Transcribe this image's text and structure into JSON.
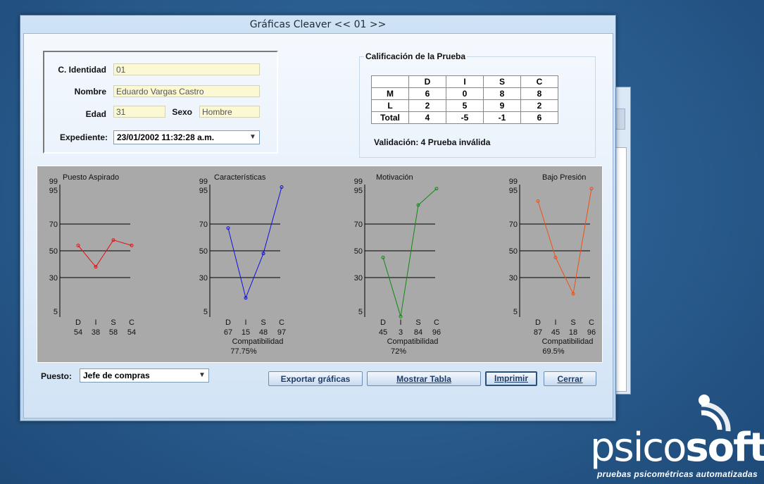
{
  "window": {
    "title": "Gráficas Cleaver << 01 >>"
  },
  "identity": {
    "ci_label": "C. Identidad",
    "ci_value": "01",
    "name_label": "Nombre",
    "name_value": "Eduardo Vargas Castro",
    "age_label": "Edad",
    "age_value": "31",
    "sex_label": "Sexo",
    "sex_value": "Hombre",
    "record_label": "Expediente:",
    "record_value": "23/01/2002 11:32:28 a.m."
  },
  "score": {
    "title": "Calificación de la Prueba",
    "columns": [
      "D",
      "I",
      "S",
      "C"
    ],
    "rows": [
      {
        "label": "M",
        "values": [
          "6",
          "0",
          "8",
          "8"
        ]
      },
      {
        "label": "L",
        "values": [
          "2",
          "5",
          "9",
          "2"
        ]
      },
      {
        "label": "Total",
        "values": [
          "4",
          "-5",
          "-1",
          "6"
        ]
      }
    ],
    "validation": "Validación: 4 Prueba inválida"
  },
  "chart_data": [
    {
      "type": "line",
      "title": "Puesto Aspirado",
      "categories": [
        "D",
        "I",
        "S",
        "C"
      ],
      "values": [
        54,
        38,
        58,
        54
      ],
      "color": "#e01010",
      "compat_label": "",
      "compat_value": ""
    },
    {
      "type": "line",
      "title": "Características",
      "categories": [
        "D",
        "I",
        "S",
        "C"
      ],
      "values": [
        67,
        15,
        48,
        97
      ],
      "color": "#1010e0",
      "compat_label": "Compatibilidad",
      "compat_value": "77.75%"
    },
    {
      "type": "line",
      "title": "Motivación",
      "categories": [
        "D",
        "I",
        "S",
        "C"
      ],
      "values": [
        45,
        3,
        84,
        96
      ],
      "color": "#0f8a0f",
      "compat_label": "Compatibilidad",
      "compat_value": "72%"
    },
    {
      "type": "line",
      "title": "Bajo Presión",
      "categories": [
        "D",
        "I",
        "S",
        "C"
      ],
      "values": [
        87,
        45,
        18,
        96
      ],
      "color": "#f05010",
      "compat_label": "Compatibilidad",
      "compat_value": "69.5%"
    }
  ],
  "chart_axis": {
    "ticks": [
      "99",
      "95",
      "70",
      "50",
      "30",
      "5"
    ]
  },
  "footer": {
    "puesto_label": "Puesto:",
    "puesto_value": "Jefe de compras",
    "export": "Exportar gráficas",
    "show_table": "Mostrar Tabla",
    "print": "Imprimir",
    "close": "Cerrar"
  },
  "logo": {
    "word_a": "psico",
    "word_b": "soft",
    "tagline": "pruebas psicométricas automatizadas"
  }
}
